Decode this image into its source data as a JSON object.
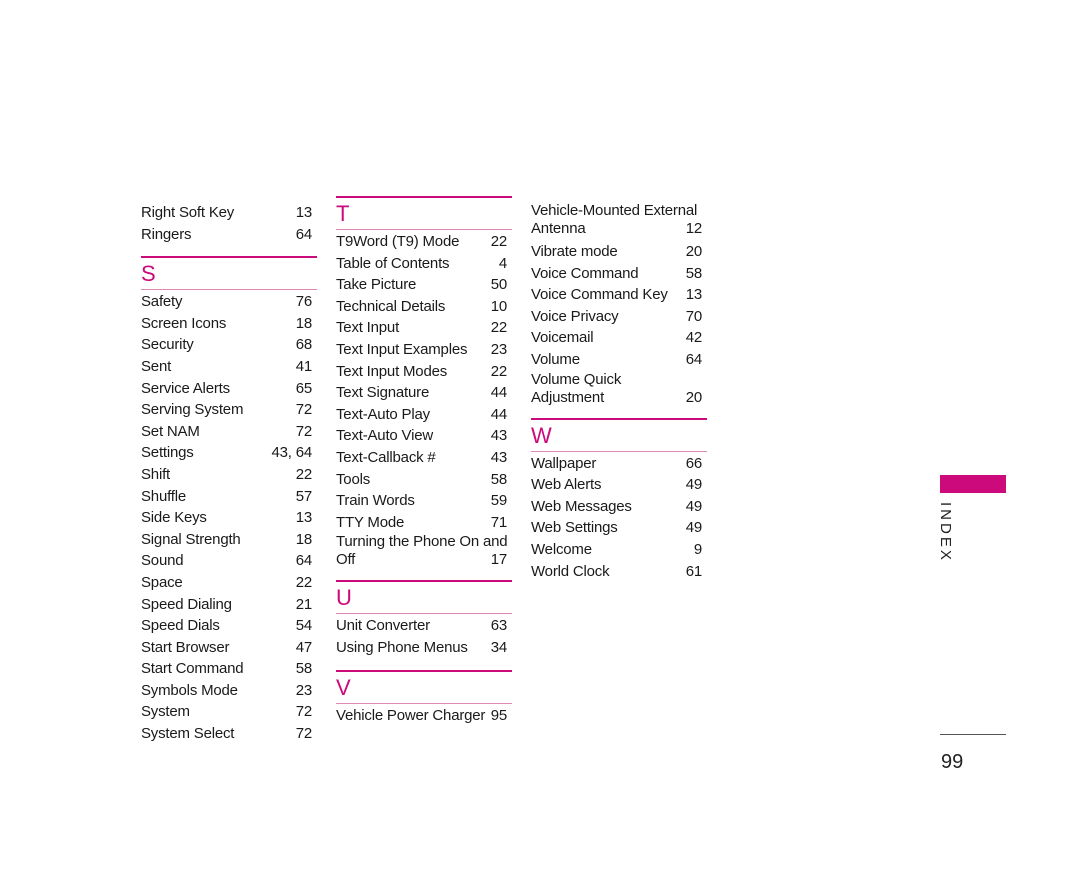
{
  "colors": {
    "accent": "#cc0a7c",
    "rule_light": "#dd88b5"
  },
  "side_tab": {
    "label": "INDEX"
  },
  "page_number": "99",
  "columns": [
    {
      "sections": [
        {
          "letter": "",
          "entries": [
            {
              "term": "Right Soft Key",
              "page": "13"
            },
            {
              "term": "Ringers",
              "page": "64"
            }
          ]
        },
        {
          "letter": "S",
          "entries": [
            {
              "term": "Safety",
              "page": "76"
            },
            {
              "term": "Screen Icons",
              "page": "18"
            },
            {
              "term": "Security",
              "page": "68"
            },
            {
              "term": "Sent",
              "page": "41"
            },
            {
              "term": "Service Alerts",
              "page": "65"
            },
            {
              "term": "Serving System",
              "page": "72"
            },
            {
              "term": "Set NAM",
              "page": "72"
            },
            {
              "term": "Settings",
              "page": "43, 64"
            },
            {
              "term": "Shift",
              "page": "22"
            },
            {
              "term": "Shuffle",
              "page": "57"
            },
            {
              "term": "Side Keys",
              "page": "13"
            },
            {
              "term": "Signal Strength",
              "page": "18"
            },
            {
              "term": "Sound",
              "page": "64"
            },
            {
              "term": "Space",
              "page": "22"
            },
            {
              "term": "Speed Dialing",
              "page": "21"
            },
            {
              "term": "Speed Dials",
              "page": "54"
            },
            {
              "term": "Start Browser",
              "page": "47"
            },
            {
              "term": "Start Command",
              "page": "58"
            },
            {
              "term": "Symbols Mode",
              "page": "23"
            },
            {
              "term": "System",
              "page": "72"
            },
            {
              "term": "System Select",
              "page": "72"
            }
          ]
        }
      ]
    },
    {
      "sections": [
        {
          "letter": "T",
          "entries": [
            {
              "term": "T9Word (T9) Mode",
              "page": "22"
            },
            {
              "term": "Table of Contents",
              "page": "4"
            },
            {
              "term": "Take Picture",
              "page": "50"
            },
            {
              "term": "Technical Details",
              "page": "10"
            },
            {
              "term": "Text Input",
              "page": "22"
            },
            {
              "term": "Text Input Examples",
              "page": "23"
            },
            {
              "term": "Text Input Modes",
              "page": "22"
            },
            {
              "term": "Text Signature",
              "page": "44"
            },
            {
              "term": "Text-Auto Play",
              "page": "44"
            },
            {
              "term": "Text-Auto View",
              "page": "43"
            },
            {
              "term": "Text-Callback #",
              "page": "43"
            },
            {
              "term": "Tools",
              "page": "58"
            },
            {
              "term": "Train Words",
              "page": "59"
            },
            {
              "term": "TTY Mode",
              "page": "71"
            },
            {
              "term": "Turning the Phone On and",
              "term2": "Off",
              "page": "17"
            }
          ]
        },
        {
          "letter": "U",
          "entries": [
            {
              "term": "Unit Converter",
              "page": "63"
            },
            {
              "term": "Using Phone Menus",
              "page": "34"
            }
          ]
        },
        {
          "letter": "V",
          "entries": [
            {
              "term": "Vehicle Power Charger",
              "page": "95"
            }
          ]
        }
      ]
    },
    {
      "sections": [
        {
          "letter": "",
          "entries": [
            {
              "term": "Vehicle-Mounted External",
              "term2": "Antenna",
              "page": "12"
            },
            {
              "term": "Vibrate mode",
              "page": "20"
            },
            {
              "term": "Voice Command",
              "page": "58"
            },
            {
              "term": "Voice Command Key",
              "page": "13"
            },
            {
              "term": "Voice Privacy",
              "page": "70"
            },
            {
              "term": "Voicemail",
              "page": "42"
            },
            {
              "term": "Volume",
              "page": "64"
            },
            {
              "term": "Volume Quick",
              "term2": "Adjustment",
              "page": "20"
            }
          ]
        },
        {
          "letter": "W",
          "entries": [
            {
              "term": "Wallpaper",
              "page": "66"
            },
            {
              "term": "Web Alerts",
              "page": "49"
            },
            {
              "term": "Web Messages",
              "page": "49"
            },
            {
              "term": "Web Settings",
              "page": "49"
            },
            {
              "term": "Welcome",
              "page": "9"
            },
            {
              "term": "World Clock",
              "page": "61"
            }
          ]
        }
      ]
    }
  ]
}
